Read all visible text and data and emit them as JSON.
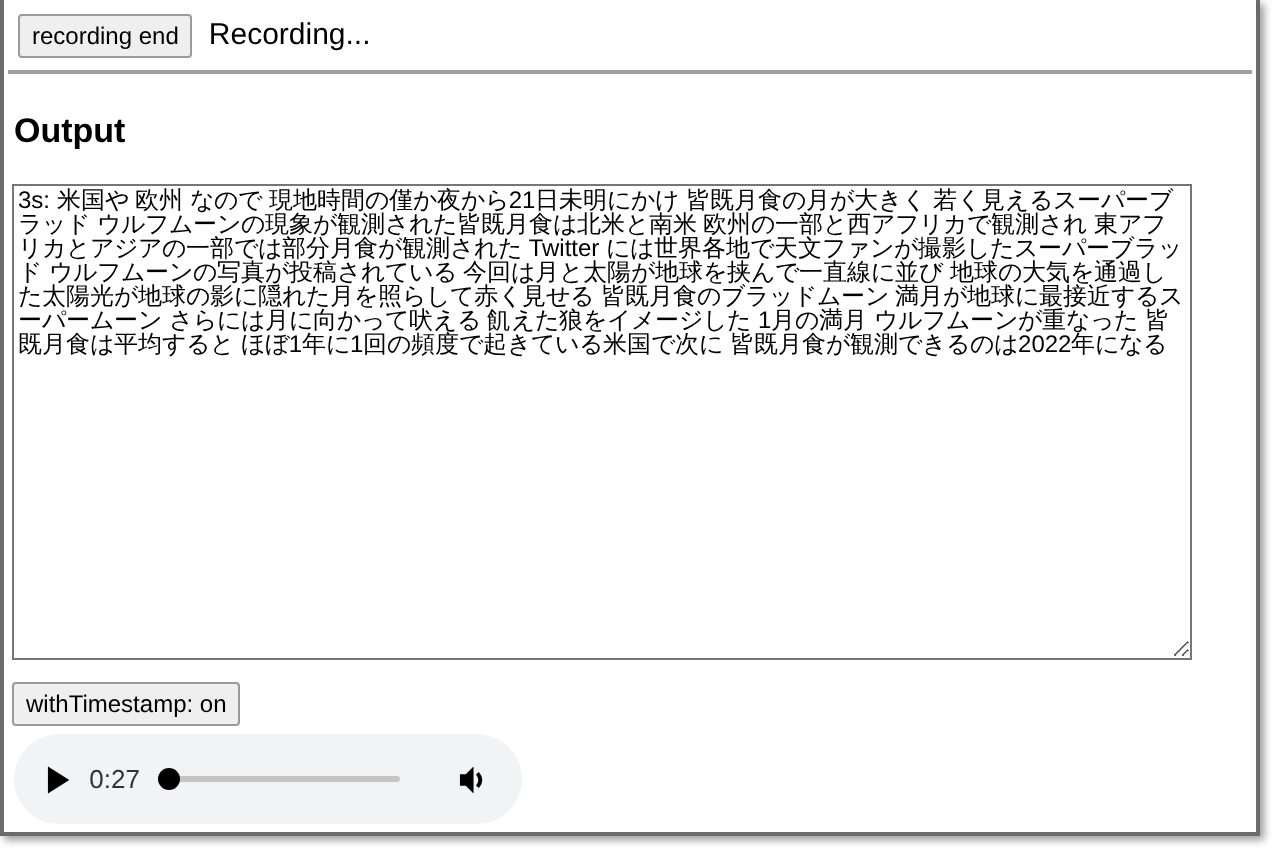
{
  "toolbar": {
    "button": "recording end",
    "status": "Recording..."
  },
  "output": {
    "heading": "Output",
    "text": "3s: 米国や 欧州 なので 現地時間の僅か夜から21日未明にかけ 皆既月食の月が大きく 若く見えるスーパーブラッド ウルフムーンの現象が観測された皆既月食は北米と南米 欧州の一部と西アフリカで観測され 東アフリカとアジアの一部では部分月食が観測された Twitter には世界各地で天文ファンが撮影したスーパーブラッド ウルフムーンの写真が投稿されている 今回は月と太陽が地球を挟んで一直線に並び 地球の大気を通過した太陽光が地球の影に隠れた月を照らして赤く見せる 皆既月食のブラッドムーン 満月が地球に最接近するスーパームーン さらには月に向かって吠える 飢えた狼をイメージした 1月の満月 ウルフムーンが重なった 皆既月食は平均すると ほぼ1年に1回の頻度で起きている米国で次に 皆既月食が観測できるのは2022年になる"
  },
  "timestamp_button": "withTimestamp: on",
  "player": {
    "time": "0:27",
    "level": 0
  }
}
